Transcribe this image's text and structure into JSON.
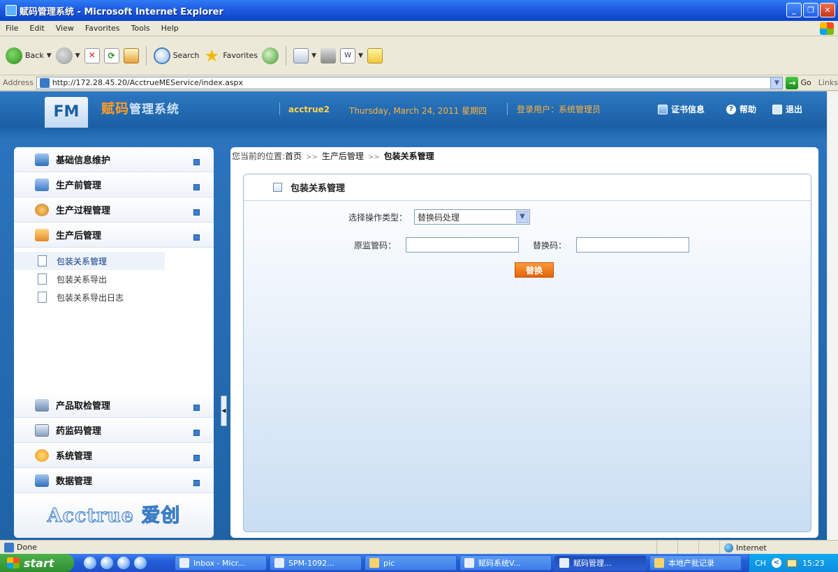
{
  "window": {
    "title": "赋码管理系统 - Microsoft Internet Explorer",
    "controls": [
      "_",
      "❐",
      "✕"
    ]
  },
  "menubar": [
    "File",
    "Edit",
    "View",
    "Favorites",
    "Tools",
    "Help"
  ],
  "toolbar": {
    "back_label": "Back",
    "search_label": "Search",
    "favorites_label": "Favorites"
  },
  "addressbar": {
    "label": "Address",
    "url": "http://172.28.45.20/AcctrueMEService/index.aspx",
    "go_label": "Go",
    "links_label": "Links"
  },
  "app": {
    "logo": "FM",
    "name_main": "赋码",
    "name_sub": "管理系统",
    "user": "acctrue2",
    "date": "Thursday, March 24, 2011 星期四",
    "login_user": "登录用户：系统管理员",
    "links": {
      "cert": "证书信息",
      "help": "帮助",
      "exit": "退出"
    }
  },
  "sidebar": {
    "top_items": [
      {
        "label": "基础信息维护"
      },
      {
        "label": "生产前管理"
      },
      {
        "label": "生产过程管理"
      },
      {
        "label": "生产后管理"
      }
    ],
    "sub_items": [
      {
        "label": "包装关系管理"
      },
      {
        "label": "包装关系导出"
      },
      {
        "label": "包装关系导出日志"
      }
    ],
    "bottom_items": [
      {
        "label": "产品取检管理"
      },
      {
        "label": "药监码管理"
      },
      {
        "label": "系统管理"
      },
      {
        "label": "数据管理"
      }
    ],
    "brand": "Acctrue 爱创"
  },
  "main": {
    "breadcrumb": {
      "prefix": "您当前的位置:",
      "home": "首页",
      "level1": "生产后管理",
      "current": "包装关系管理"
    },
    "panel_title": "包装关系管理",
    "form": {
      "op_type_label": "选择操作类型：",
      "op_type_value": "替换码处理",
      "original_label": "原监管码：",
      "original_value": "",
      "replacement_label": "替换码：",
      "replacement_value": "",
      "submit_label": "替换"
    }
  },
  "statusbar": {
    "status": "Done",
    "zone": "Internet"
  },
  "taskbar": {
    "start": "start",
    "tasks": [
      "Inbox - Micr...",
      "SPM-1092...",
      "pic",
      "赋码系统V...",
      "赋码管理...",
      "本地产批记录"
    ],
    "lang": "CH",
    "clock": "15:23"
  }
}
